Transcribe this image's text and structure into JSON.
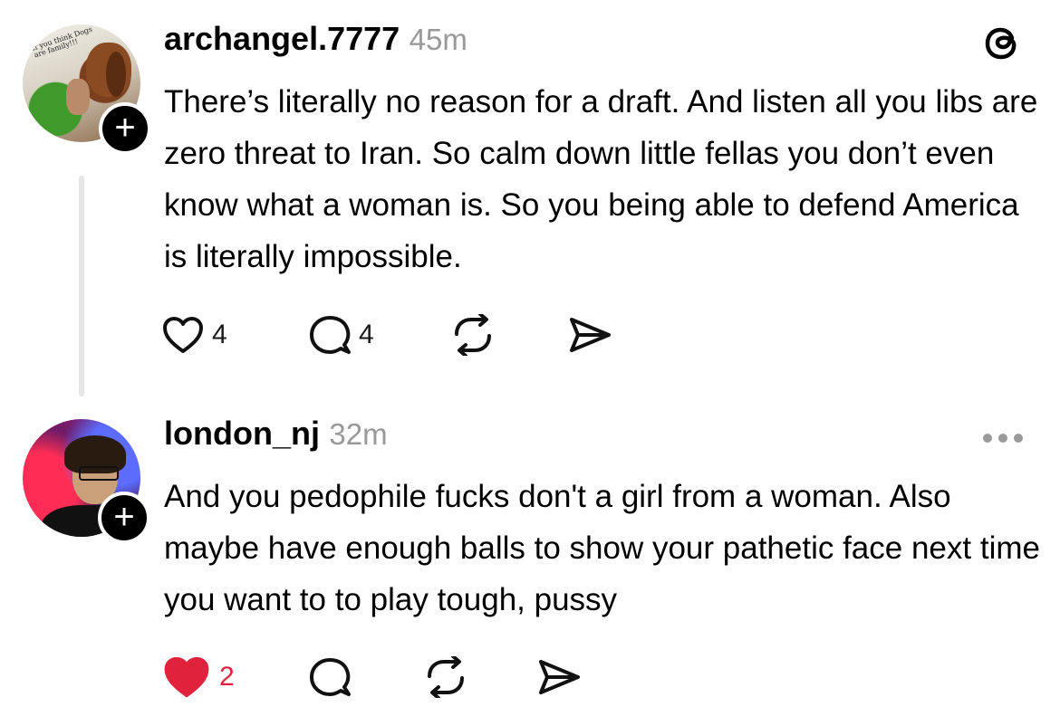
{
  "posts": [
    {
      "username": "archangel.7777",
      "time": "45m",
      "avatar_caption": "If you think Dogs are family!!!",
      "text": "There’s literally no reason for a draft. And listen all you libs are zero threat to Iran. So calm down little fellas you don’t even know what a woman is. So you being able to defend America is literally impossible.",
      "likes": "4",
      "replies": "4",
      "liked": false,
      "corner_icon": "threads-logo-icon"
    },
    {
      "username": "london_nj",
      "time": "32m",
      "text": "And you pedophile fucks don't a girl from a woman. Also maybe have enough balls to show your pathetic face next time you want to to play tough, pussy",
      "likes": "2",
      "replies": "",
      "liked": true,
      "corner_icon": "more-options-icon"
    }
  ],
  "icons": {
    "like": "heart-icon",
    "reply": "comment-bubble-icon",
    "repost": "repost-icon",
    "share": "send-icon",
    "follow": "plus-icon"
  },
  "colors": {
    "text": "#000000",
    "muted": "#999999",
    "like_active": "#e0223c",
    "thread_line": "#e6e6e6"
  }
}
